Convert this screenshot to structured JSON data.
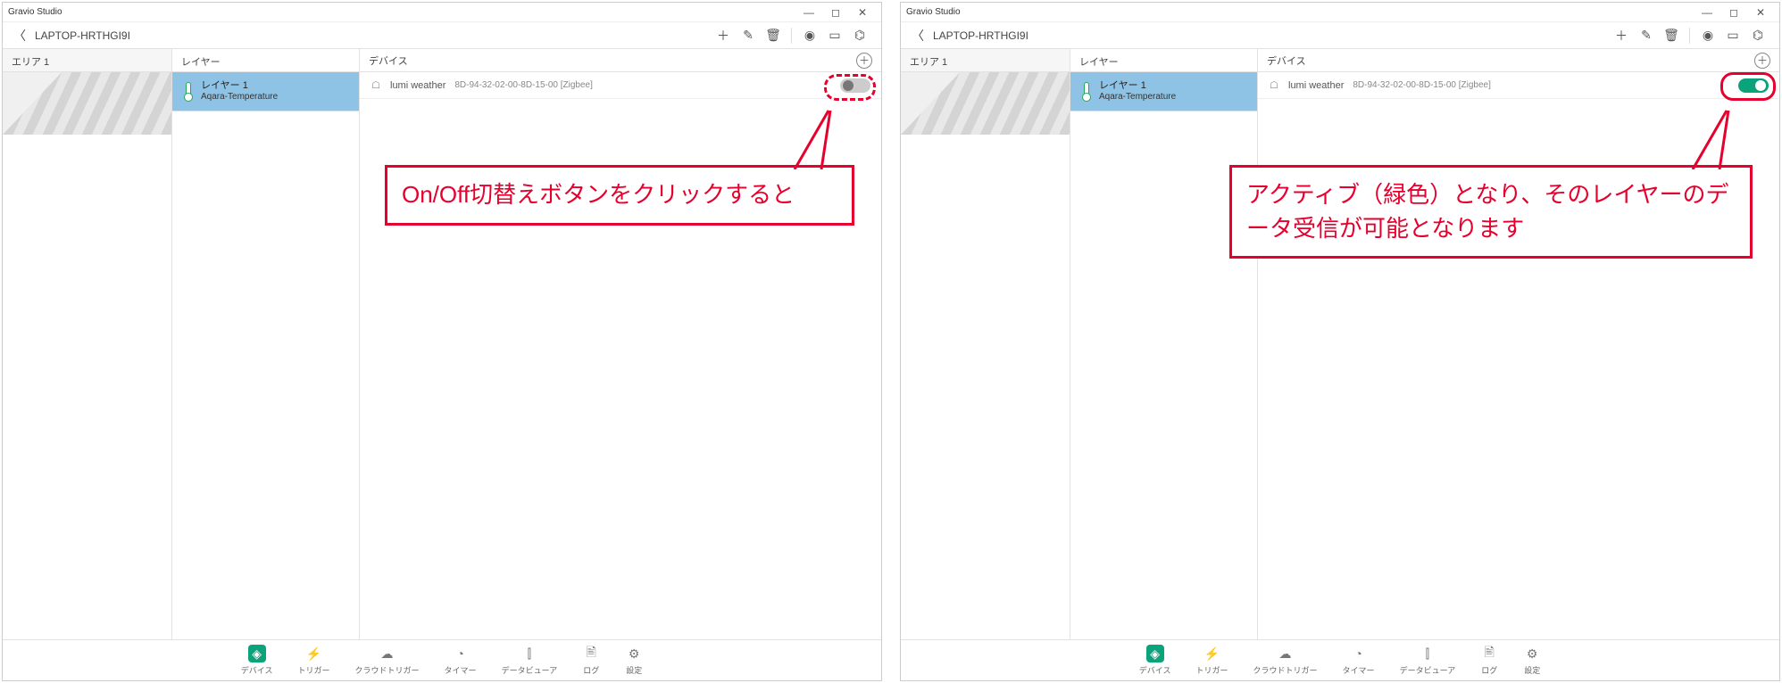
{
  "app_title": "Gravio Studio",
  "host_name": "LAPTOP-HRTHGI9I",
  "columns": {
    "area_header": "エリア 1",
    "layer_header": "レイヤー",
    "device_header": "デバイス"
  },
  "layer": {
    "name": "レイヤー 1",
    "type": "Aqara-Temperature"
  },
  "device": {
    "name": "lumi weather",
    "mac": "8D-94-32-02-00-8D-15-00 [Zigbee]"
  },
  "bottom_tabs": {
    "device": "デバイス",
    "trigger": "トリガー",
    "cloud_trigger": "クラウドトリガー",
    "timer": "タイマー",
    "data_viewer": "データビューア",
    "log": "ログ",
    "settings": "設定"
  },
  "callout_left": "On/Off切替えボタンをクリックすると",
  "callout_right": "アクティブ（緑色）となり、そのレイヤーのデータ受信が可能となります"
}
